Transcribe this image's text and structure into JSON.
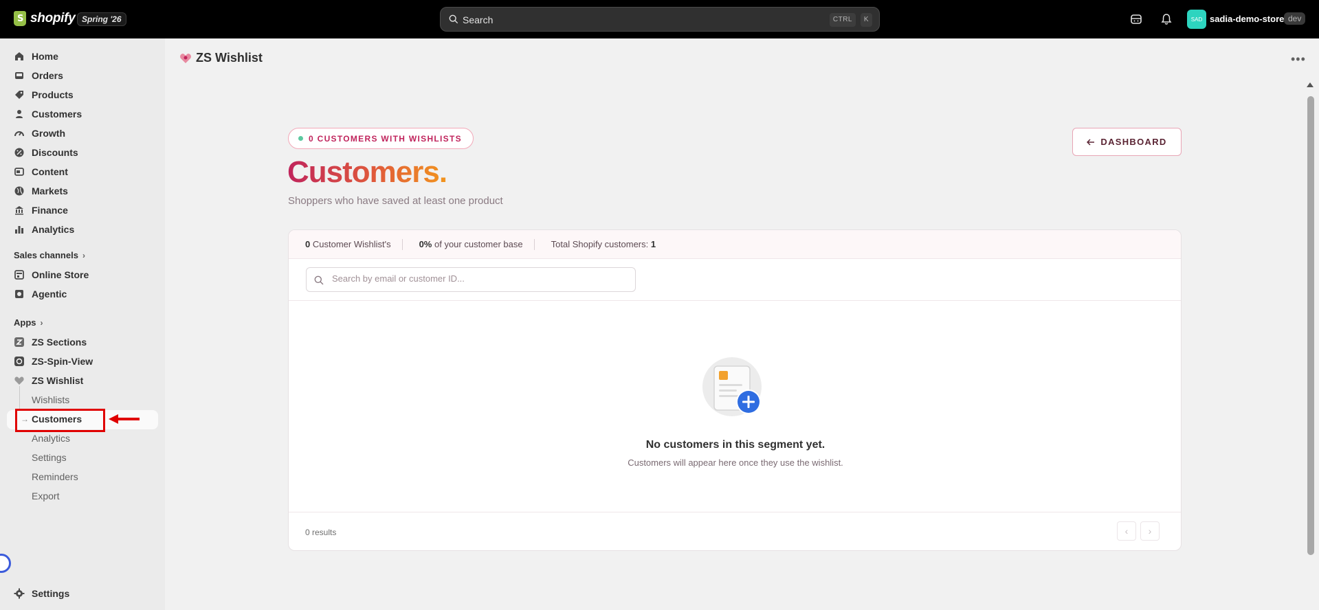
{
  "topbar": {
    "brand": "shopify",
    "release_badge": "Spring '26",
    "search_label": "Search",
    "shortcut_ctrl": "CTRL",
    "shortcut_key": "K",
    "store_avatar": "SAD",
    "store_name": "sadia-demo-store",
    "store_badge": "dev"
  },
  "sidebar": {
    "items": [
      {
        "label": "Home",
        "icon": "home-icon"
      },
      {
        "label": "Orders",
        "icon": "inbox-icon"
      },
      {
        "label": "Products",
        "icon": "tag-icon"
      },
      {
        "label": "Customers",
        "icon": "person-icon"
      },
      {
        "label": "Growth",
        "icon": "gauge-icon"
      },
      {
        "label": "Discounts",
        "icon": "discount-icon"
      },
      {
        "label": "Content",
        "icon": "content-icon"
      },
      {
        "label": "Markets",
        "icon": "globe-icon"
      },
      {
        "label": "Finance",
        "icon": "bank-icon"
      },
      {
        "label": "Analytics",
        "icon": "bar-chart-icon"
      }
    ],
    "sales_channels_label": "Sales channels",
    "sales_channels": [
      {
        "label": "Online Store",
        "icon": "store-icon"
      },
      {
        "label": "Agentic",
        "icon": "agentic-icon"
      }
    ],
    "apps_label": "Apps",
    "apps": [
      {
        "label": "ZS Sections",
        "icon": "zs-sections-icon"
      },
      {
        "label": "ZS-Spin-View",
        "icon": "spin-view-icon"
      },
      {
        "label": "ZS Wishlist",
        "icon": "wishlist-icon"
      }
    ],
    "wishlist_sub": [
      "Wishlists",
      "Customers",
      "Analytics",
      "Settings",
      "Reminders",
      "Export"
    ],
    "settings_label": "Settings"
  },
  "app_header": {
    "title": "ZS Wishlist"
  },
  "page": {
    "pill_label": "0 CUSTOMERS WITH WISHLISTS",
    "title": "Customers.",
    "subtitle": "Shoppers who have saved at least one product",
    "dashboard_button": "DASHBOARD"
  },
  "stats": {
    "wishlist_count": "0",
    "wishlist_label": "Customer Wishlist's",
    "percent_value": "0%",
    "percent_label": "of your customer base",
    "total_label": "Total Shopify customers:",
    "total_value": "1"
  },
  "search": {
    "placeholder": "Search by email or customer ID..."
  },
  "empty_state": {
    "title": "No customers in this segment yet.",
    "description": "Customers will appear here once they use the wishlist."
  },
  "footer": {
    "results": "0 results",
    "prev": "‹",
    "next": "›"
  },
  "colors": {
    "accent": "#c0245c",
    "accent_orange": "#f2951e",
    "highlight": "#e00000"
  }
}
